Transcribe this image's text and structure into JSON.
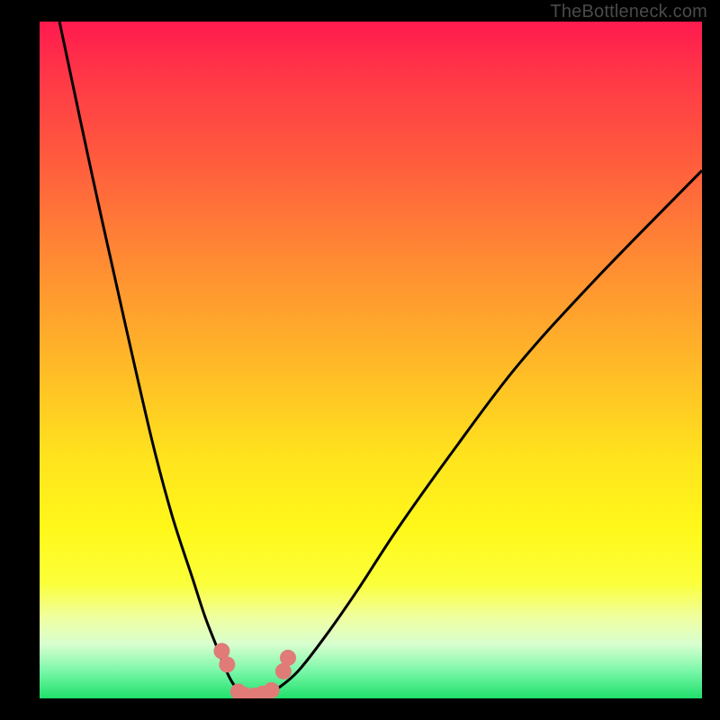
{
  "watermark": "TheBottleneck.com",
  "colors": {
    "background": "#000000",
    "curve": "#000000",
    "marker": "#e07b78",
    "gradient_top": "#ff1a4f",
    "gradient_bottom": "#1fe06a"
  },
  "chart_data": {
    "type": "line",
    "title": "",
    "xlabel": "",
    "ylabel": "",
    "xlim": [
      0,
      100
    ],
    "ylim": [
      0,
      100
    ],
    "series": [
      {
        "name": "left-curve",
        "x": [
          3,
          8,
          13,
          17,
          20,
          23,
          25,
          27,
          28,
          29,
          30,
          31,
          32
        ],
        "values": [
          100,
          77,
          55,
          38,
          27,
          18,
          12,
          7,
          4.5,
          2.5,
          1.2,
          0.4,
          0
        ]
      },
      {
        "name": "right-curve",
        "x": [
          32,
          34,
          36,
          39,
          43,
          48,
          54,
          62,
          72,
          84,
          100
        ],
        "values": [
          0,
          0.4,
          1.5,
          4,
          9,
          16,
          25,
          36,
          49,
          62,
          78
        ]
      }
    ],
    "markers": [
      {
        "x": 27.5,
        "y": 7.0
      },
      {
        "x": 28.3,
        "y": 5.0
      },
      {
        "x": 30.0,
        "y": 1.0
      },
      {
        "x": 31.0,
        "y": 0.5
      },
      {
        "x": 32.5,
        "y": 0.4
      },
      {
        "x": 33.7,
        "y": 0.7
      },
      {
        "x": 35.0,
        "y": 1.2
      },
      {
        "x": 36.8,
        "y": 4.0
      },
      {
        "x": 37.5,
        "y": 6.0
      }
    ]
  }
}
